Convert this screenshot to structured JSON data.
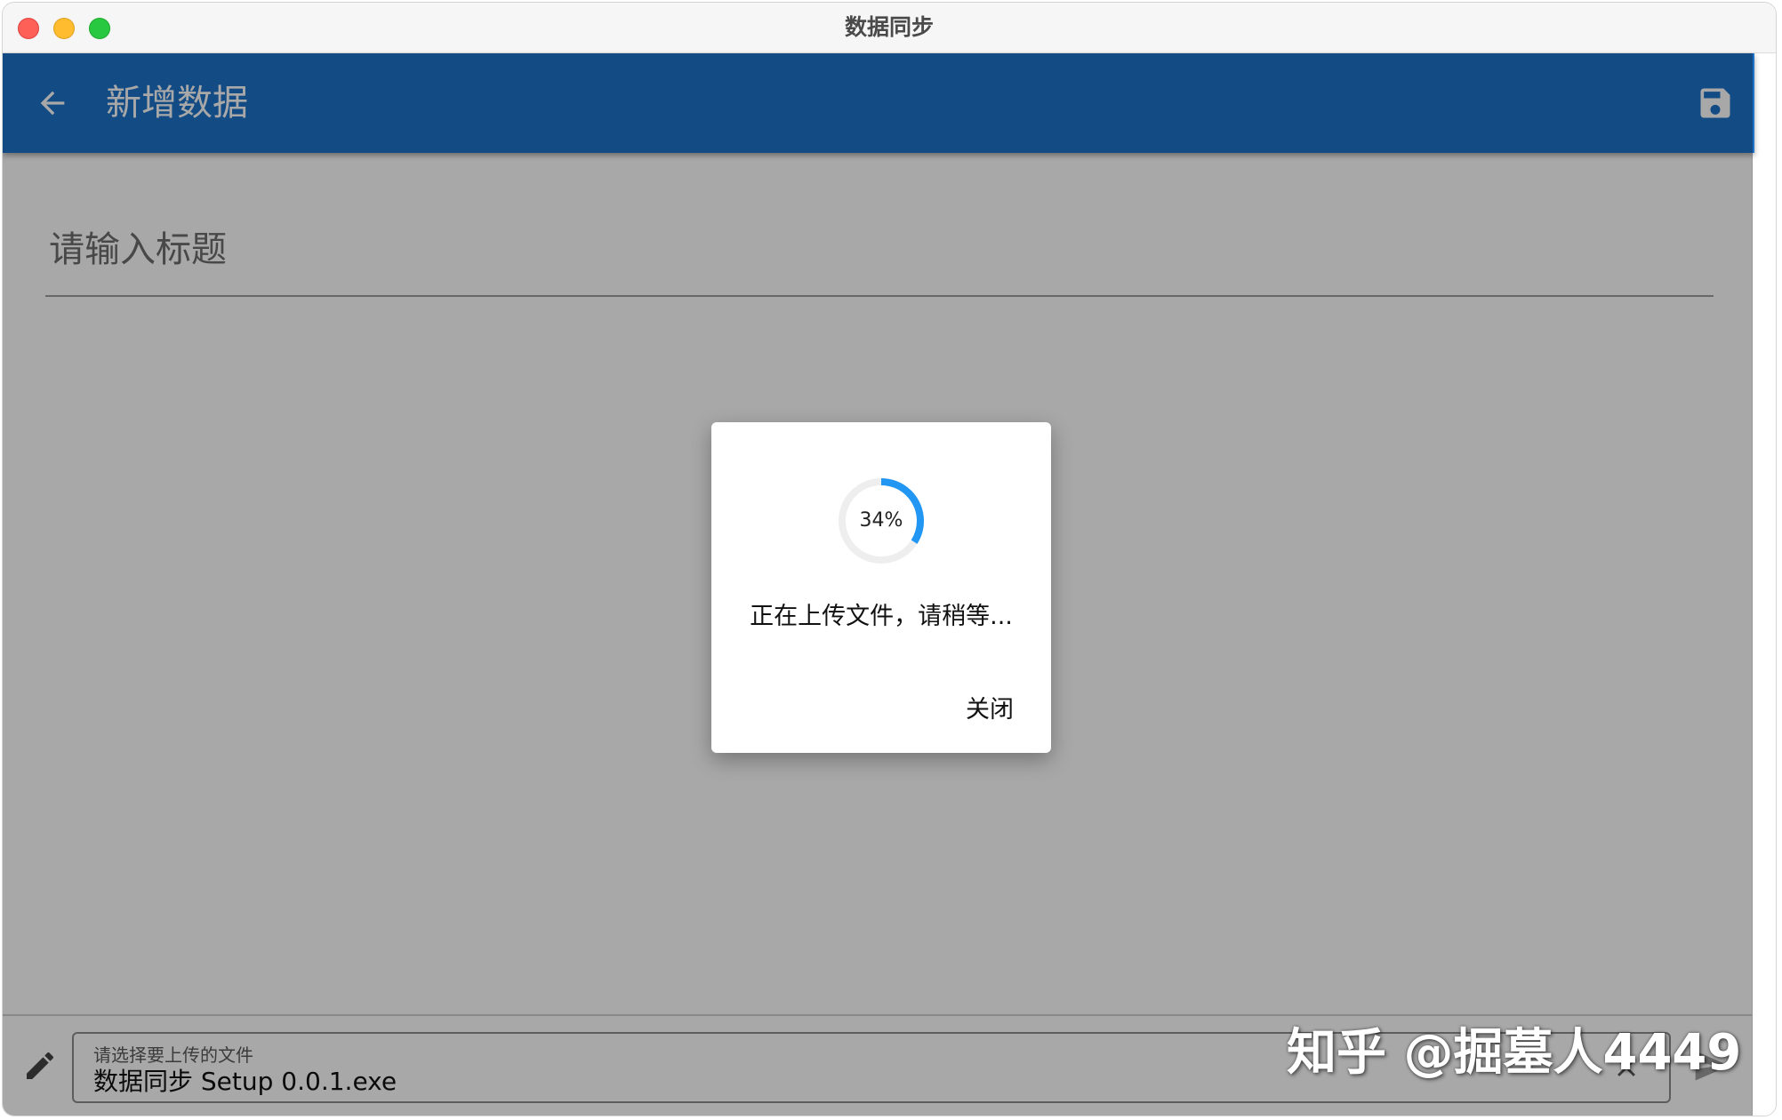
{
  "window": {
    "title": "数据同步"
  },
  "appbar": {
    "title": "新增数据",
    "back_icon": "arrow-back-icon",
    "save_icon": "save-icon",
    "color": "#1e73c8"
  },
  "form": {
    "title_placeholder": "请输入标题",
    "title_value": ""
  },
  "bottom_bar": {
    "file_label": "请选择要上传的文件",
    "file_value": "数据同步 Setup 0.0.1.exe",
    "edit_icon": "pencil-icon",
    "clear_icon": "close-icon",
    "send_icon": "send-icon"
  },
  "dialog": {
    "progress_percent": 34,
    "progress_text": "34%",
    "message": "正在上传文件，请稍等...",
    "close_label": "关闭",
    "progress_color": "#2196f3",
    "track_color": "#eeeeee"
  },
  "watermark": {
    "text": "知乎 @掘墓人4449"
  }
}
